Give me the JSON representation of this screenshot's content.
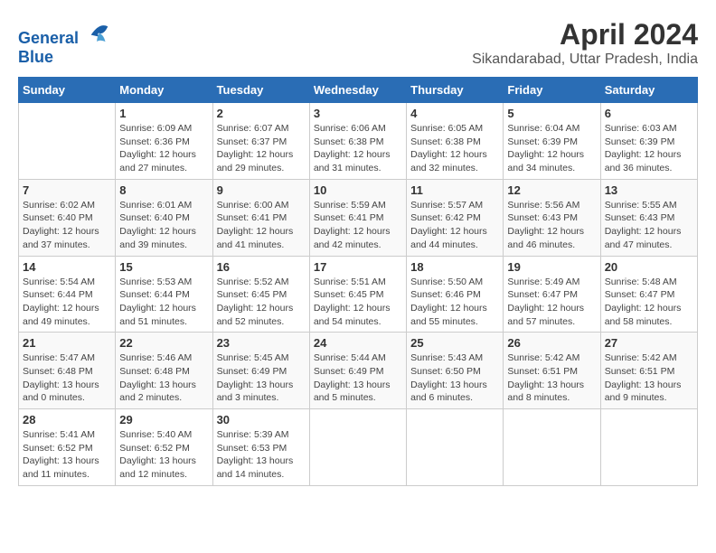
{
  "header": {
    "logo_line1": "General",
    "logo_line2": "Blue",
    "month_title": "April 2024",
    "location": "Sikandarabad, Uttar Pradesh, India"
  },
  "weekdays": [
    "Sunday",
    "Monday",
    "Tuesday",
    "Wednesday",
    "Thursday",
    "Friday",
    "Saturday"
  ],
  "weeks": [
    [
      {
        "day": "",
        "info": ""
      },
      {
        "day": "1",
        "info": "Sunrise: 6:09 AM\nSunset: 6:36 PM\nDaylight: 12 hours\nand 27 minutes."
      },
      {
        "day": "2",
        "info": "Sunrise: 6:07 AM\nSunset: 6:37 PM\nDaylight: 12 hours\nand 29 minutes."
      },
      {
        "day": "3",
        "info": "Sunrise: 6:06 AM\nSunset: 6:38 PM\nDaylight: 12 hours\nand 31 minutes."
      },
      {
        "day": "4",
        "info": "Sunrise: 6:05 AM\nSunset: 6:38 PM\nDaylight: 12 hours\nand 32 minutes."
      },
      {
        "day": "5",
        "info": "Sunrise: 6:04 AM\nSunset: 6:39 PM\nDaylight: 12 hours\nand 34 minutes."
      },
      {
        "day": "6",
        "info": "Sunrise: 6:03 AM\nSunset: 6:39 PM\nDaylight: 12 hours\nand 36 minutes."
      }
    ],
    [
      {
        "day": "7",
        "info": "Sunrise: 6:02 AM\nSunset: 6:40 PM\nDaylight: 12 hours\nand 37 minutes."
      },
      {
        "day": "8",
        "info": "Sunrise: 6:01 AM\nSunset: 6:40 PM\nDaylight: 12 hours\nand 39 minutes."
      },
      {
        "day": "9",
        "info": "Sunrise: 6:00 AM\nSunset: 6:41 PM\nDaylight: 12 hours\nand 41 minutes."
      },
      {
        "day": "10",
        "info": "Sunrise: 5:59 AM\nSunset: 6:41 PM\nDaylight: 12 hours\nand 42 minutes."
      },
      {
        "day": "11",
        "info": "Sunrise: 5:57 AM\nSunset: 6:42 PM\nDaylight: 12 hours\nand 44 minutes."
      },
      {
        "day": "12",
        "info": "Sunrise: 5:56 AM\nSunset: 6:43 PM\nDaylight: 12 hours\nand 46 minutes."
      },
      {
        "day": "13",
        "info": "Sunrise: 5:55 AM\nSunset: 6:43 PM\nDaylight: 12 hours\nand 47 minutes."
      }
    ],
    [
      {
        "day": "14",
        "info": "Sunrise: 5:54 AM\nSunset: 6:44 PM\nDaylight: 12 hours\nand 49 minutes."
      },
      {
        "day": "15",
        "info": "Sunrise: 5:53 AM\nSunset: 6:44 PM\nDaylight: 12 hours\nand 51 minutes."
      },
      {
        "day": "16",
        "info": "Sunrise: 5:52 AM\nSunset: 6:45 PM\nDaylight: 12 hours\nand 52 minutes."
      },
      {
        "day": "17",
        "info": "Sunrise: 5:51 AM\nSunset: 6:45 PM\nDaylight: 12 hours\nand 54 minutes."
      },
      {
        "day": "18",
        "info": "Sunrise: 5:50 AM\nSunset: 6:46 PM\nDaylight: 12 hours\nand 55 minutes."
      },
      {
        "day": "19",
        "info": "Sunrise: 5:49 AM\nSunset: 6:47 PM\nDaylight: 12 hours\nand 57 minutes."
      },
      {
        "day": "20",
        "info": "Sunrise: 5:48 AM\nSunset: 6:47 PM\nDaylight: 12 hours\nand 58 minutes."
      }
    ],
    [
      {
        "day": "21",
        "info": "Sunrise: 5:47 AM\nSunset: 6:48 PM\nDaylight: 13 hours\nand 0 minutes."
      },
      {
        "day": "22",
        "info": "Sunrise: 5:46 AM\nSunset: 6:48 PM\nDaylight: 13 hours\nand 2 minutes."
      },
      {
        "day": "23",
        "info": "Sunrise: 5:45 AM\nSunset: 6:49 PM\nDaylight: 13 hours\nand 3 minutes."
      },
      {
        "day": "24",
        "info": "Sunrise: 5:44 AM\nSunset: 6:49 PM\nDaylight: 13 hours\nand 5 minutes."
      },
      {
        "day": "25",
        "info": "Sunrise: 5:43 AM\nSunset: 6:50 PM\nDaylight: 13 hours\nand 6 minutes."
      },
      {
        "day": "26",
        "info": "Sunrise: 5:42 AM\nSunset: 6:51 PM\nDaylight: 13 hours\nand 8 minutes."
      },
      {
        "day": "27",
        "info": "Sunrise: 5:42 AM\nSunset: 6:51 PM\nDaylight: 13 hours\nand 9 minutes."
      }
    ],
    [
      {
        "day": "28",
        "info": "Sunrise: 5:41 AM\nSunset: 6:52 PM\nDaylight: 13 hours\nand 11 minutes."
      },
      {
        "day": "29",
        "info": "Sunrise: 5:40 AM\nSunset: 6:52 PM\nDaylight: 13 hours\nand 12 minutes."
      },
      {
        "day": "30",
        "info": "Sunrise: 5:39 AM\nSunset: 6:53 PM\nDaylight: 13 hours\nand 14 minutes."
      },
      {
        "day": "",
        "info": ""
      },
      {
        "day": "",
        "info": ""
      },
      {
        "day": "",
        "info": ""
      },
      {
        "day": "",
        "info": ""
      }
    ]
  ]
}
